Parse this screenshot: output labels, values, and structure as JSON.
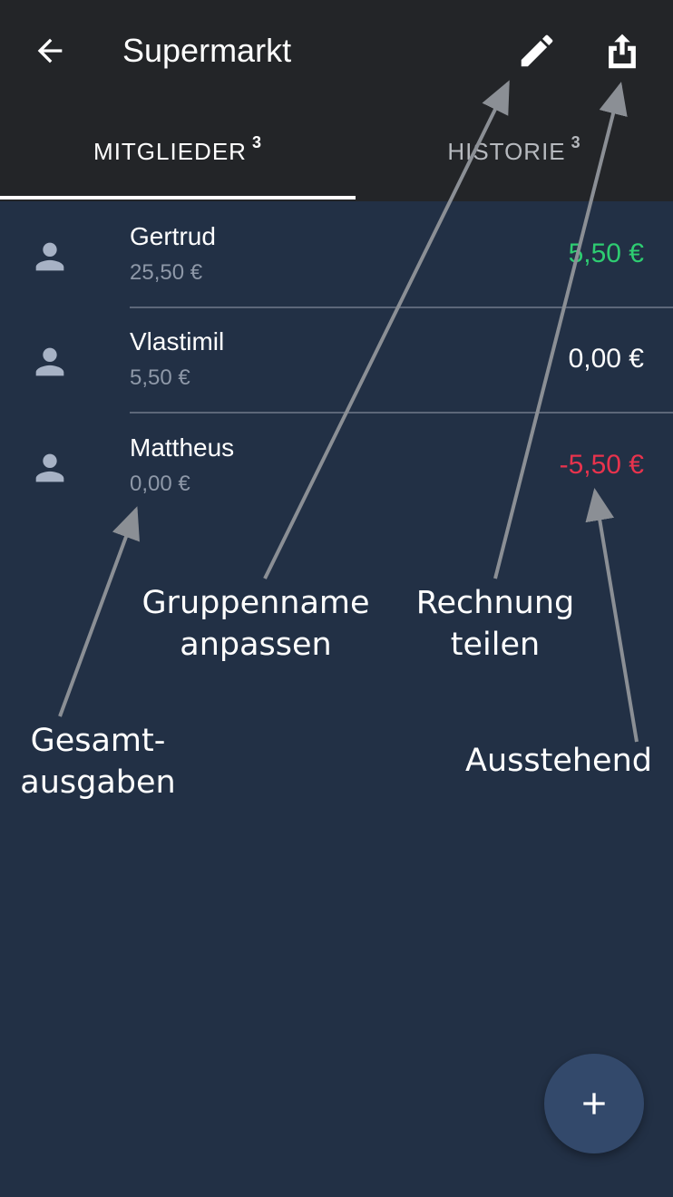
{
  "appbar": {
    "title": "Supermarkt",
    "back_icon": "arrow-left-icon",
    "edit_icon": "pencil-icon",
    "share_icon": "share-icon"
  },
  "tabs": [
    {
      "label": "MITGLIEDER",
      "count": "3",
      "active": true
    },
    {
      "label": "HISTORIE",
      "count": "3",
      "active": false
    }
  ],
  "members": [
    {
      "name": "Gertrud",
      "spent": "25,50 €",
      "balance": "5,50 €",
      "balance_color": "#2ecc71"
    },
    {
      "name": "Vlastimil",
      "spent": "5,50 €",
      "balance": "0,00 €",
      "balance_color": "#ffffff"
    },
    {
      "name": "Mattheus",
      "spent": "0,00 €",
      "balance": "-5,50 €",
      "balance_color": "#e8334d"
    }
  ],
  "annotations": {
    "rename": [
      "Gruppenname",
      "anpassen"
    ],
    "share": [
      "Rechnung",
      "teilen"
    ],
    "total": [
      "Gesamt-",
      "ausgaben"
    ],
    "outstanding": [
      "Ausstehend"
    ]
  },
  "fab": {
    "icon": "plus-icon"
  },
  "colors": {
    "background": "#223045",
    "appbar": "#232528",
    "positive": "#2ecc71",
    "negative": "#e8334d",
    "fab": "#33496b"
  }
}
